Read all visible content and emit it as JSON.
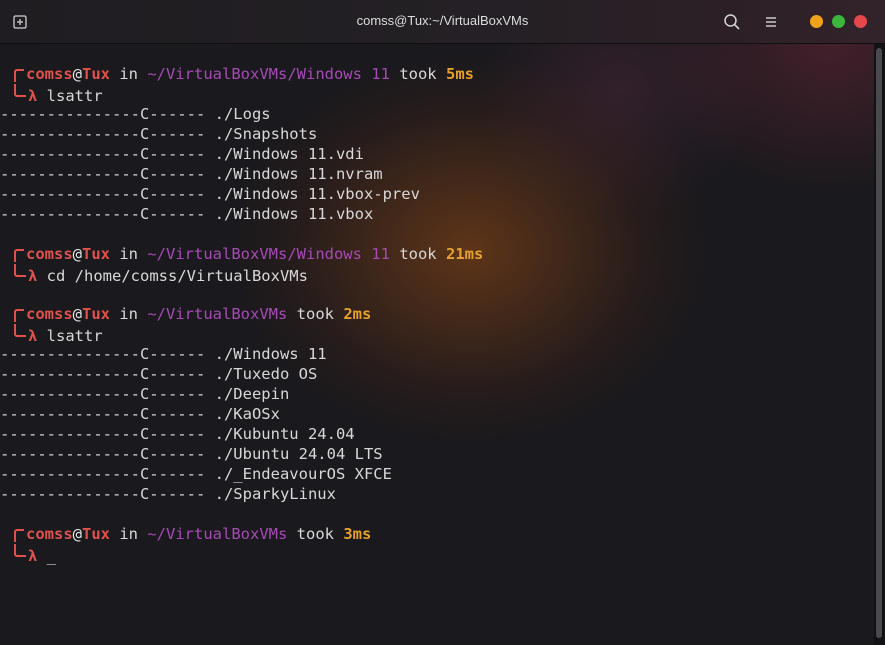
{
  "window": {
    "title": "comss@Tux:~/VirtualBoxVMs"
  },
  "icons": {
    "new_tab": "new-tab-icon",
    "search": "search-icon",
    "menu": "hamburger-menu-icon"
  },
  "colors": {
    "user": "#e0514c",
    "path": "#a64ab6",
    "duration": "#e6a02c",
    "minimize": "#f0a21b",
    "maximize": "#3bb83b",
    "close": "#e5474a"
  },
  "terminal": {
    "blocks": [
      {
        "prompt": {
          "user": "comss",
          "at": "@",
          "host": "Tux",
          "in": " in ",
          "path": "~/VirtualBoxVMs/Windows 11",
          "took": " took ",
          "duration": "5ms"
        },
        "lambda": "λ",
        "command": " lsattr",
        "output": [
          "---------------C------ ./Logs",
          "---------------C------ ./Snapshots",
          "---------------C------ ./Windows 11.vdi",
          "---------------C------ ./Windows 11.nvram",
          "---------------C------ ./Windows 11.vbox-prev",
          "---------------C------ ./Windows 11.vbox"
        ]
      },
      {
        "prompt": {
          "user": "comss",
          "at": "@",
          "host": "Tux",
          "in": " in ",
          "path": "~/VirtualBoxVMs/Windows 11",
          "took": " took ",
          "duration": "21ms"
        },
        "lambda": "λ",
        "command": " cd /home/comss/VirtualBoxVMs",
        "output": []
      },
      {
        "prompt": {
          "user": "comss",
          "at": "@",
          "host": "Tux",
          "in": " in ",
          "path": "~/VirtualBoxVMs",
          "took": " took ",
          "duration": "2ms"
        },
        "lambda": "λ",
        "command": " lsattr",
        "output": [
          "---------------C------ ./Windows 11",
          "---------------C------ ./Tuxedo OS",
          "---------------C------ ./Deepin",
          "---------------C------ ./KaOSx",
          "---------------C------ ./Kubuntu 24.04",
          "---------------C------ ./Ubuntu 24.04 LTS",
          "---------------C------ ./_EndeavourOS XFCE",
          "---------------C------ ./SparkyLinux"
        ]
      },
      {
        "prompt": {
          "user": "comss",
          "at": "@",
          "host": "Tux",
          "in": " in ",
          "path": "~/VirtualBoxVMs",
          "took": " took ",
          "duration": "3ms"
        },
        "lambda": "λ",
        "command": " _",
        "output": []
      }
    ]
  }
}
